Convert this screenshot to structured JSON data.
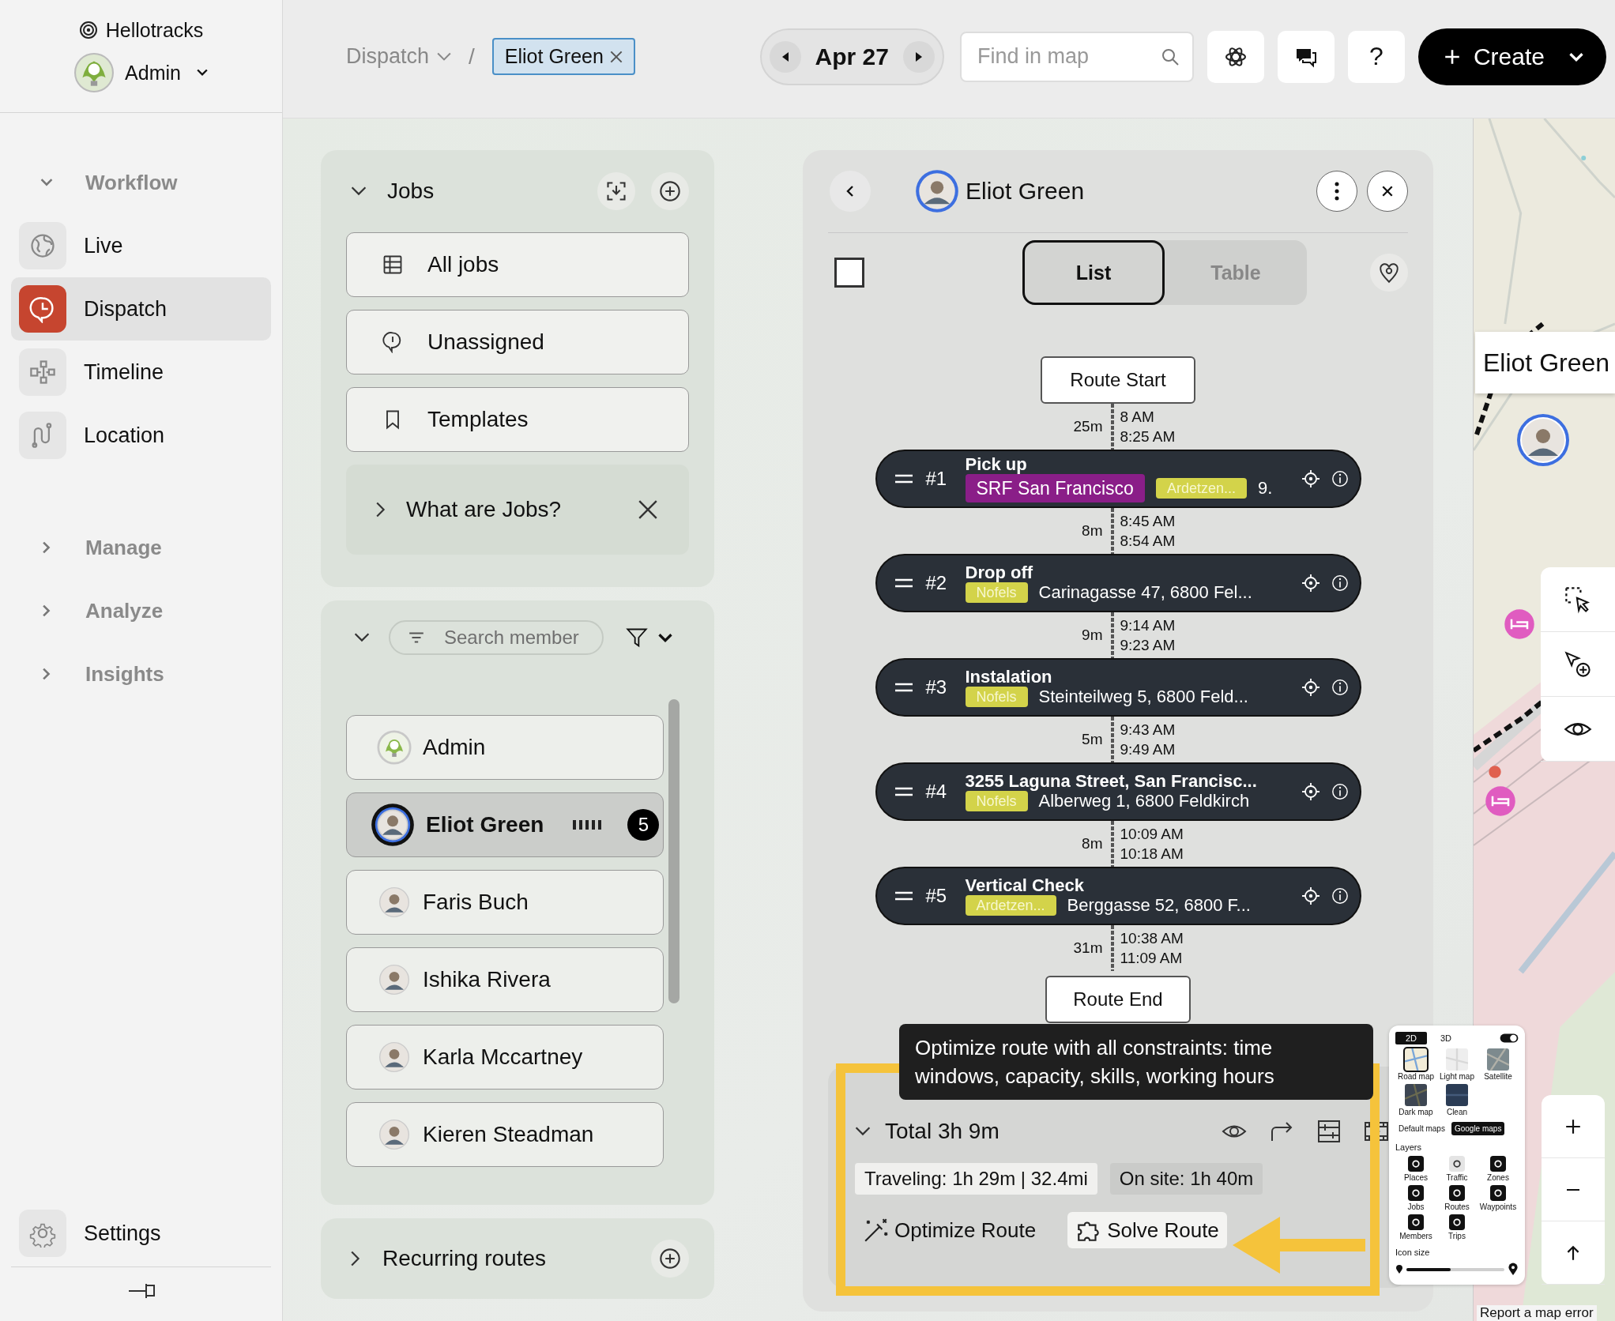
{
  "sidebar": {
    "brand": "Hellotracks",
    "account": "Admin",
    "groups": [
      {
        "label": "Workflow",
        "expanded": true,
        "items": [
          {
            "label": "Live",
            "selected": false
          },
          {
            "label": "Dispatch",
            "selected": true
          },
          {
            "label": "Timeline",
            "selected": false
          },
          {
            "label": "Location",
            "selected": false
          }
        ]
      },
      {
        "label": "Manage",
        "expanded": false
      },
      {
        "label": "Analyze",
        "expanded": false
      },
      {
        "label": "Insights",
        "expanded": false
      }
    ],
    "settings": "Settings"
  },
  "topbar": {
    "breadcrumb": "Dispatch",
    "separator": "/",
    "filter_chip": "Eliot Green",
    "date": "Apr 27",
    "search": {
      "placeholder": "Find in map"
    },
    "help": "?",
    "create": "Create"
  },
  "jobs": {
    "title": "Jobs",
    "items": [
      "All jobs",
      "Unassigned",
      "Templates"
    ],
    "info": "What are Jobs?"
  },
  "members": {
    "search": {
      "placeholder": "Search member"
    },
    "items": [
      {
        "name": "Admin",
        "selected": false
      },
      {
        "name": "Eliot Green",
        "selected": true,
        "count": "5"
      },
      {
        "name": "Faris Buch",
        "selected": false
      },
      {
        "name": "Ishika Rivera",
        "selected": false
      },
      {
        "name": "Karla Mccartney",
        "selected": false
      },
      {
        "name": "Kieren Steadman",
        "selected": false
      }
    ]
  },
  "recurring": {
    "title": "Recurring routes"
  },
  "route": {
    "member": "Eliot Green",
    "select_all": {
      "checked": false
    },
    "tabs": [
      {
        "label": "List",
        "selected": true
      },
      {
        "label": "Table",
        "selected": false
      }
    ],
    "start": "Route Start",
    "end": "Route End",
    "legs": [
      {
        "duration": "25m",
        "arrive": "8 AM",
        "depart": "8:25 AM"
      },
      {
        "duration": "8m",
        "arrive": "8:45 AM",
        "depart": "8:54 AM"
      },
      {
        "duration": "9m",
        "arrive": "9:14 AM",
        "depart": "9:23 AM"
      },
      {
        "duration": "5m",
        "arrive": "9:43 AM",
        "depart": "9:49 AM"
      },
      {
        "duration": "8m",
        "arrive": "10:09 AM",
        "depart": "10:18 AM"
      },
      {
        "duration": "31m",
        "arrive": "10:38 AM",
        "depart": "11:09 AM"
      }
    ],
    "stops": [
      {
        "number": "#1",
        "title": "Pick up",
        "tags": [
          {
            "label": "SRF San Francisco",
            "color": "#8a1e88"
          },
          {
            "label": "Ardetzen...",
            "color": "#d3d34a"
          }
        ],
        "address": "9."
      },
      {
        "number": "#2",
        "title": "Drop off",
        "tags": [
          {
            "label": "Nofels",
            "color": "#d3d34a"
          }
        ],
        "address": "Carinagasse 47, 6800 Fel..."
      },
      {
        "number": "#3",
        "title": "Instalation",
        "tags": [
          {
            "label": "Nofels",
            "color": "#d3d34a"
          }
        ],
        "address": "Steinteilweg 5, 6800 Feld..."
      },
      {
        "number": "#4",
        "title": "3255 Laguna Street, San Francisc...",
        "tags": [
          {
            "label": "Nofels",
            "color": "#d3d34a"
          }
        ],
        "address": "Alberweg 1, 6800 Feldkirch"
      },
      {
        "number": "#5",
        "title": "Vertical Check",
        "tags": [
          {
            "label": "Ardetzen...",
            "color": "#d3d34a"
          }
        ],
        "address": "Berggasse 52, 6800 F..."
      }
    ],
    "summary": {
      "total": "Total 3h 9m",
      "traveling": "Traveling: 1h 29m | 32.4mi",
      "on_site": "On site: 1h 40m",
      "actions": [
        "Optimize Route",
        "Solve Route"
      ]
    },
    "tooltip": "Optimize route with all constraints: time windows, capacity, skills, working hours"
  },
  "map": {
    "marker_label": "Eliot Green",
    "layers_panel": {
      "views": [
        {
          "label": "2D",
          "selected": true
        },
        {
          "label": "3D",
          "selected": false
        }
      ],
      "styles": [
        {
          "label": "Road map",
          "selected": true
        },
        {
          "label": "Light map",
          "selected": false
        },
        {
          "label": "Satellite",
          "selected": false
        },
        {
          "label": "Dark map",
          "selected": false
        },
        {
          "label": "Clean",
          "selected": false
        }
      ],
      "sources": [
        {
          "label": "Default maps",
          "selected": false
        },
        {
          "label": "Google maps",
          "selected": true
        }
      ],
      "layers_title": "Layers",
      "layers": [
        "Places",
        "Traffic",
        "Zones",
        "Jobs",
        "Routes",
        "Waypoints",
        "Members",
        "Trips"
      ],
      "icon_size_title": "Icon size",
      "icon_size": {
        "level": 0.45
      }
    },
    "report": "Report a map error"
  }
}
